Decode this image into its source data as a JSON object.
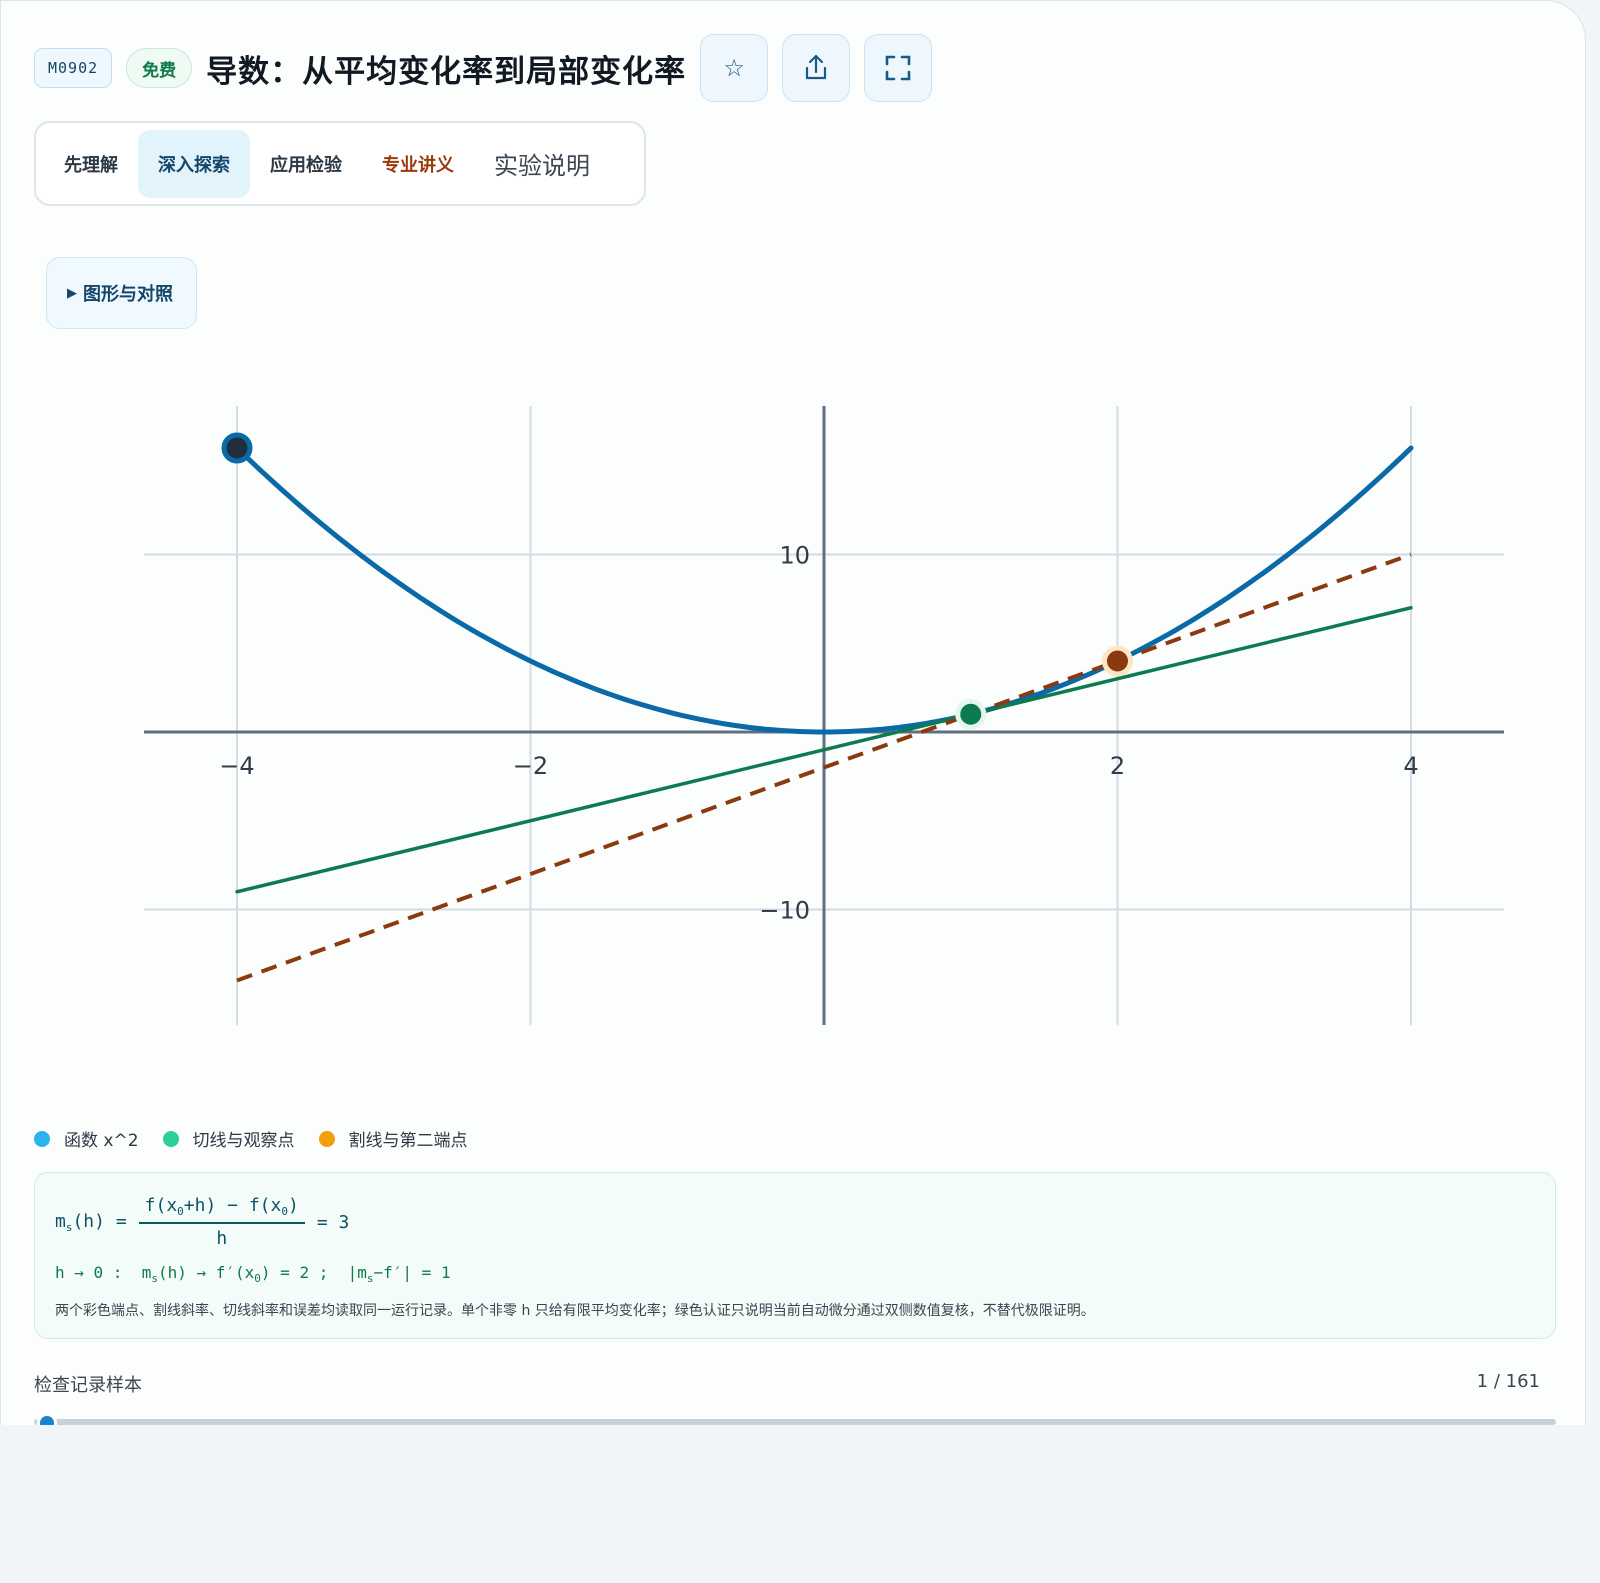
{
  "header": {
    "code": "M0902",
    "badge": "免费",
    "title": "导数：从平均变化率到局部变化率",
    "actions": [
      {
        "name": "star-icon",
        "glyph": "☆"
      },
      {
        "name": "share-icon",
        "glyph": "share"
      },
      {
        "name": "fullscreen-icon",
        "glyph": "fullscreen"
      }
    ]
  },
  "tabs": [
    "先理解",
    "深入探索",
    "应用检验",
    "专业讲义",
    "实验说明"
  ],
  "active_tab": "深入探索",
  "section_toggle": "图形与对照",
  "chart_data": {
    "type": "line",
    "x_ticks": [
      "−4",
      "−2",
      "2",
      "4"
    ],
    "y_ticks": [
      "10",
      "−10"
    ],
    "xlim": [
      -5.2,
      4.6
    ],
    "ylim": [
      -16.5,
      18.5
    ],
    "grid": true,
    "series": [
      {
        "role": "function",
        "color": "#0a6aa8",
        "width": 5,
        "dash": false,
        "x_range": [
          -4,
          4
        ],
        "expr": "x^2"
      },
      {
        "role": "tangent",
        "color": "#0e7a50",
        "width": 3.5,
        "dash": false,
        "x_range": [
          -4,
          4
        ],
        "slope": 2,
        "intercept": -1
      },
      {
        "role": "secant",
        "color": "#8b3a0f",
        "width": 4,
        "dash": true,
        "x_range": [
          -4,
          4
        ],
        "slope": 3,
        "intercept": -2
      }
    ],
    "points": [
      {
        "x": -4,
        "y": 16,
        "fill": "#1f2f3c",
        "stroke": "#0a6aa8"
      },
      {
        "x": 1,
        "y": 1,
        "fill": "#0e7a50",
        "stroke": "#e3f7ec"
      },
      {
        "x": 2,
        "y": 4,
        "fill": "#8b3a0f",
        "stroke": "#fbe7c6"
      }
    ]
  },
  "legend": [
    {
      "label": "函数 x^2",
      "color": "#2cb2ec"
    },
    {
      "label": "切线与观察点",
      "color": "#2ccf95"
    },
    {
      "label": "割线与第二端点",
      "color": "#f59e0b"
    }
  ],
  "formula": {
    "value": "3",
    "limit_value": "2",
    "error_value": "1",
    "note": "两个彩色端点、割线斜率、切线斜率和误差均读取同一运行记录。单个非零 h 只给有限平均变化率；绿色认证只说明当前自动微分通过双侧数值复核，不替代极限证明。"
  },
  "sample": {
    "label": "检查记录样本",
    "count": "1 / 161",
    "position": 0
  }
}
